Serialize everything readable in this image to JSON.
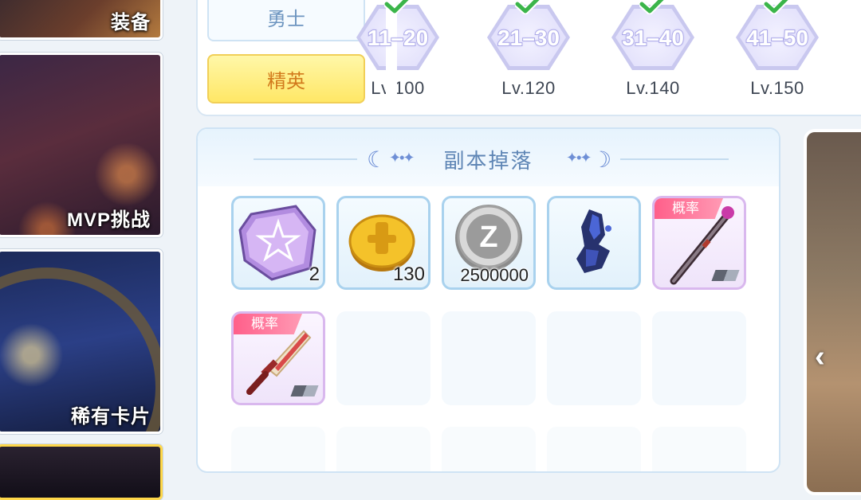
{
  "mode_cards": [
    {
      "label": "装备"
    },
    {
      "label": "MVP挑战"
    },
    {
      "label": "稀有卡片"
    },
    {
      "label": ""
    }
  ],
  "difficulty": {
    "options": [
      {
        "label": "勇士",
        "selected": false
      },
      {
        "label": "精英",
        "selected": true
      }
    ]
  },
  "level_tiers": [
    {
      "range": "11–20",
      "level": "Lv.100",
      "cleared": true
    },
    {
      "range": "21–30",
      "level": "Lv.120",
      "cleared": true
    },
    {
      "range": "31–40",
      "level": "Lv.140",
      "cleared": true
    },
    {
      "range": "41–50",
      "level": "Lv.150",
      "cleared": true
    }
  ],
  "drops": {
    "title": "副本掉落",
    "items": [
      {
        "icon": "purple-star-ore-icon",
        "quantity": "2"
      },
      {
        "icon": "gold-coin-icon",
        "quantity": "130"
      },
      {
        "icon": "zeny-coin-icon",
        "quantity": "2500000"
      },
      {
        "icon": "blue-crystal-icon",
        "quantity": ""
      },
      {
        "icon": "staff-icon",
        "tag": "概率"
      },
      {
        "icon": "sword-icon",
        "tag": "概率"
      }
    ]
  },
  "colors": {
    "accent_blue": "#5f86b5",
    "elite_yellow": "#ffe766",
    "chance_pink": "#ff5f8a"
  }
}
